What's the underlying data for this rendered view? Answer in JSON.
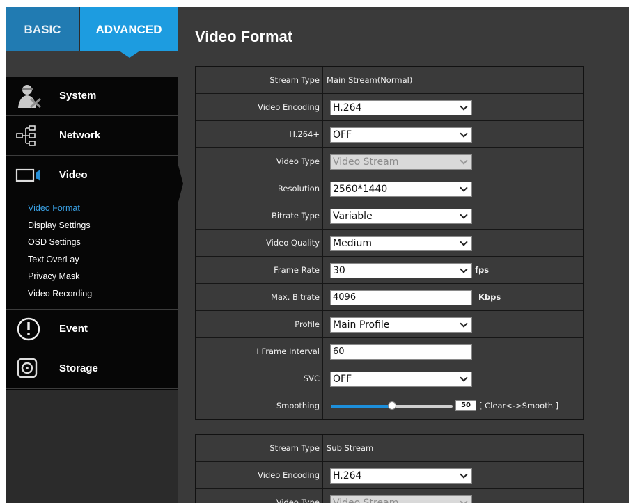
{
  "tabs": {
    "basic": "BASIC",
    "advanced": "ADVANCED"
  },
  "sidebar": {
    "items": [
      {
        "label": "System",
        "icon": "system-icon"
      },
      {
        "label": "Network",
        "icon": "network-icon"
      },
      {
        "label": "Video",
        "icon": "video-camera-icon"
      },
      {
        "label": "Event",
        "icon": "exclamation-icon"
      },
      {
        "label": "Storage",
        "icon": "storage-disk-icon"
      }
    ],
    "video_submenu": [
      "Video Format",
      "Display Settings",
      "OSD Settings",
      "Text OverLay",
      "Privacy Mask",
      "Video Recording"
    ],
    "active_submenu": "Video Format"
  },
  "page": {
    "title": "Video Format"
  },
  "main_stream": {
    "stream_type_label": "Stream Type",
    "stream_type_value": "Main Stream(Normal)",
    "video_encoding_label": "Video Encoding",
    "video_encoding_value": "H.264",
    "h264plus_label": "H.264+",
    "h264plus_value": "OFF",
    "video_type_label": "Video Type",
    "video_type_value": "Video Stream",
    "resolution_label": "Resolution",
    "resolution_value": "2560*1440",
    "bitrate_type_label": "Bitrate Type",
    "bitrate_type_value": "Variable",
    "video_quality_label": "Video Quality",
    "video_quality_value": "Medium",
    "frame_rate_label": "Frame Rate",
    "frame_rate_value": "30",
    "frame_rate_unit": "fps",
    "max_bitrate_label": "Max. Bitrate",
    "max_bitrate_value": "4096",
    "max_bitrate_unit": "Kbps",
    "profile_label": "Profile",
    "profile_value": "Main Profile",
    "iframe_label": "I Frame Interval",
    "iframe_value": "60",
    "svc_label": "SVC",
    "svc_value": "OFF",
    "smoothing_label": "Smoothing",
    "smoothing_value": "50",
    "smoothing_fraction": 0.5,
    "smoothing_hint": "[ Clear<->Smooth ]"
  },
  "sub_stream": {
    "stream_type_label": "Stream Type",
    "stream_type_value": "Sub Stream",
    "video_encoding_label": "Video Encoding",
    "video_encoding_value": "H.264",
    "video_type_label": "Video Type",
    "video_type_value": "Video Stream"
  },
  "colors": {
    "accent": "#1d9ce0",
    "basic_tab": "#217bb2",
    "active_link": "#3aa2e6",
    "panel_bg": "#3a3a3a",
    "nav_bg": "#060606"
  }
}
